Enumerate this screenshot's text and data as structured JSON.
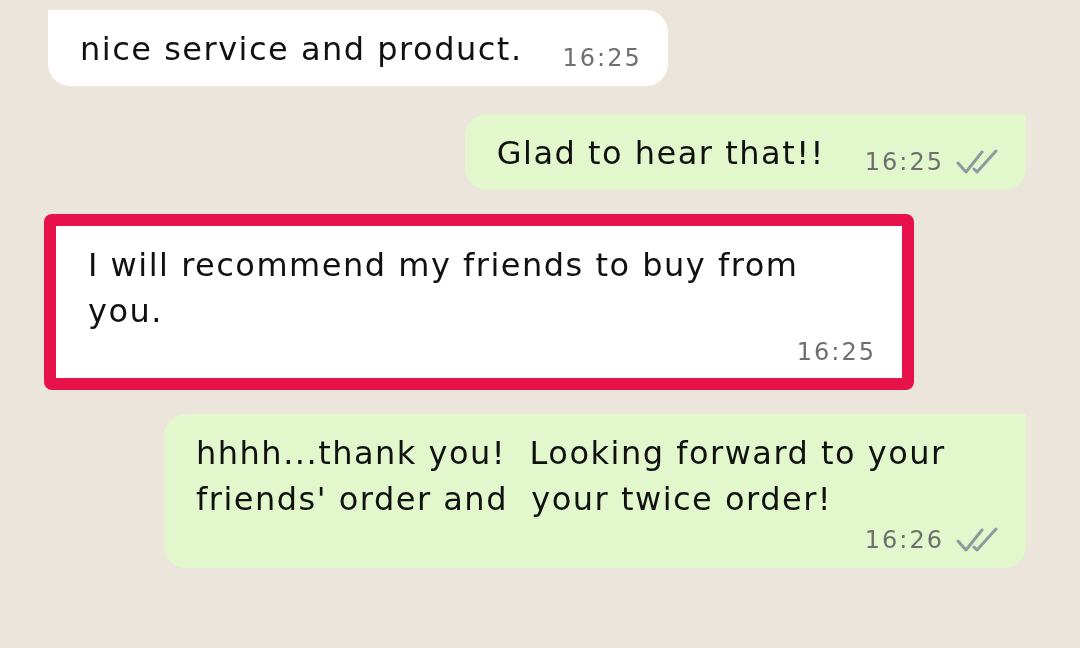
{
  "messages": [
    {
      "kind": "incoming",
      "text": "nice service and product.",
      "time": "16:25",
      "highlighted": false
    },
    {
      "kind": "outgoing",
      "text": "Glad to hear that!!",
      "time": "16:25",
      "highlighted": false,
      "read": false
    },
    {
      "kind": "incoming",
      "text": "I will recommend my friends to buy from you.",
      "time": "16:25",
      "highlighted": true
    },
    {
      "kind": "outgoing",
      "text": "hhhh...thank you!  Looking forward to your friends' order and  your twice order!",
      "time": "16:26",
      "highlighted": false,
      "read": false
    }
  ]
}
